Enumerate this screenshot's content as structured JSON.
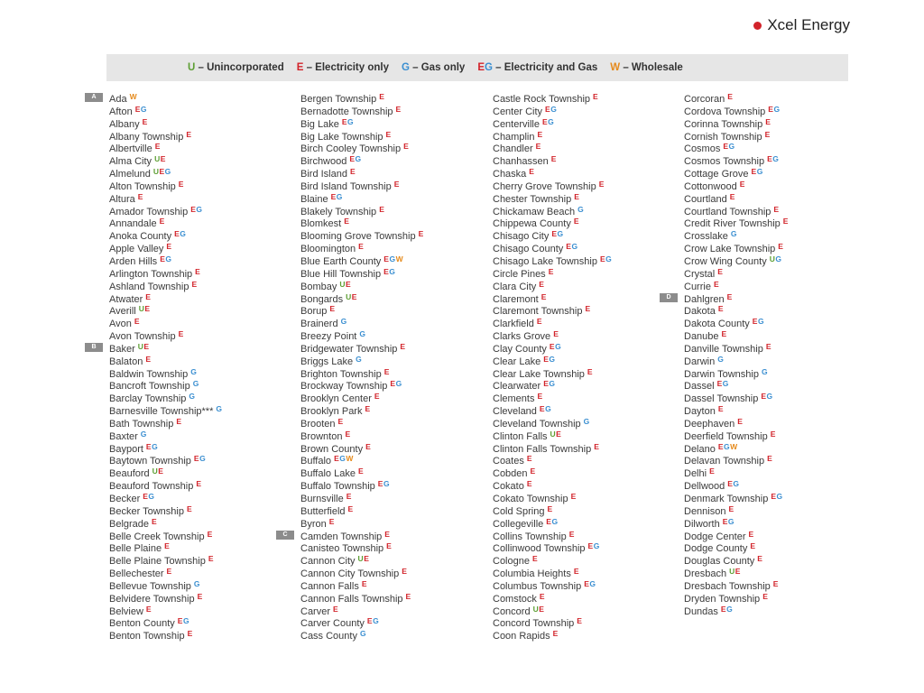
{
  "brand": {
    "name": "Xcel Energy"
  },
  "colors": {
    "U": "#5c9e32",
    "E": "#d2232a",
    "G": "#3b8fd1",
    "W": "#e58a1c",
    "legend_bg": "#e6e6e6"
  },
  "legend": [
    {
      "code": "U",
      "text": "– Unincorporated"
    },
    {
      "code": "E",
      "text": "– Electricity only"
    },
    {
      "code": "G",
      "text": "– Gas only"
    },
    {
      "code": "EG",
      "text": "– Electricity and Gas"
    },
    {
      "code": "W",
      "text": "– Wholesale"
    }
  ],
  "columns": [
    [
      {
        "name": "Ada",
        "codes": "W",
        "letter": "A"
      },
      {
        "name": "Afton",
        "codes": "EG"
      },
      {
        "name": "Albany",
        "codes": "E"
      },
      {
        "name": "Albany Township",
        "codes": "E"
      },
      {
        "name": "Albertville",
        "codes": "E"
      },
      {
        "name": "Alma City",
        "codes": "UE"
      },
      {
        "name": "Almelund",
        "codes": "UEG"
      },
      {
        "name": "Alton Township",
        "codes": "E"
      },
      {
        "name": "Altura",
        "codes": "E"
      },
      {
        "name": "Amador Township",
        "codes": "EG"
      },
      {
        "name": "Annandale",
        "codes": "E"
      },
      {
        "name": "Anoka County",
        "codes": "EG"
      },
      {
        "name": "Apple Valley",
        "codes": "E"
      },
      {
        "name": "Arden Hills",
        "codes": "EG"
      },
      {
        "name": "Arlington Township",
        "codes": "E"
      },
      {
        "name": "Ashland Township",
        "codes": "E"
      },
      {
        "name": "Atwater",
        "codes": "E"
      },
      {
        "name": "Averill",
        "codes": "UE"
      },
      {
        "name": "Avon",
        "codes": "E"
      },
      {
        "name": "Avon Township",
        "codes": "E"
      },
      {
        "name": "Baker",
        "codes": "UE",
        "letter": "B"
      },
      {
        "name": "Balaton",
        "codes": "E"
      },
      {
        "name": "Baldwin Township",
        "codes": "G"
      },
      {
        "name": "Bancroft Township",
        "codes": "G"
      },
      {
        "name": "Barclay Township",
        "codes": "G"
      },
      {
        "name": "Barnesville Township***",
        "codes": "G"
      },
      {
        "name": "Bath Township",
        "codes": "E"
      },
      {
        "name": "Baxter",
        "codes": "G"
      },
      {
        "name": "Bayport",
        "codes": "EG"
      },
      {
        "name": "Baytown Township",
        "codes": "EG"
      },
      {
        "name": "Beauford",
        "codes": "UE"
      },
      {
        "name": "Beauford Township",
        "codes": "E"
      },
      {
        "name": "Becker",
        "codes": "EG"
      },
      {
        "name": "Becker Township",
        "codes": "E"
      },
      {
        "name": "Belgrade",
        "codes": "E"
      },
      {
        "name": "Belle Creek Township",
        "codes": "E"
      },
      {
        "name": "Belle Plaine",
        "codes": "E"
      },
      {
        "name": "Belle Plaine Township",
        "codes": "E"
      },
      {
        "name": "Bellechester",
        "codes": "E"
      },
      {
        "name": "Bellevue Township",
        "codes": "G"
      },
      {
        "name": "Belvidere Township",
        "codes": "E"
      },
      {
        "name": "Belview",
        "codes": "E"
      },
      {
        "name": "Benton County",
        "codes": "EG"
      },
      {
        "name": "Benton Township",
        "codes": "E"
      }
    ],
    [
      {
        "name": "Bergen Township",
        "codes": "E"
      },
      {
        "name": "Bernadotte Township",
        "codes": "E"
      },
      {
        "name": "Big Lake",
        "codes": "EG"
      },
      {
        "name": "Big Lake Township",
        "codes": "E"
      },
      {
        "name": "Birch Cooley Township",
        "codes": "E"
      },
      {
        "name": "Birchwood",
        "codes": "EG"
      },
      {
        "name": "Bird Island",
        "codes": "E"
      },
      {
        "name": "Bird Island Township",
        "codes": "E"
      },
      {
        "name": "Blaine",
        "codes": "EG"
      },
      {
        "name": "Blakely Township",
        "codes": "E"
      },
      {
        "name": "Blomkest",
        "codes": "E"
      },
      {
        "name": "Blooming Grove Township",
        "codes": "E"
      },
      {
        "name": "Bloomington",
        "codes": "E"
      },
      {
        "name": "Blue Earth County",
        "codes": "EGW"
      },
      {
        "name": "Blue Hill Township",
        "codes": "EG"
      },
      {
        "name": "Bombay",
        "codes": "UE"
      },
      {
        "name": "Bongards",
        "codes": "UE"
      },
      {
        "name": "Borup",
        "codes": "E"
      },
      {
        "name": "Brainerd",
        "codes": "G"
      },
      {
        "name": "Breezy Point",
        "codes": "G"
      },
      {
        "name": "Bridgewater Township",
        "codes": "E"
      },
      {
        "name": "Briggs Lake",
        "codes": "G"
      },
      {
        "name": "Brighton Township",
        "codes": "E"
      },
      {
        "name": "Brockway Township",
        "codes": "EG"
      },
      {
        "name": "Brooklyn Center",
        "codes": "E"
      },
      {
        "name": "Brooklyn Park",
        "codes": "E"
      },
      {
        "name": "Brooten",
        "codes": "E"
      },
      {
        "name": "Brownton",
        "codes": "E"
      },
      {
        "name": "Brown County",
        "codes": "E"
      },
      {
        "name": "Buffalo",
        "codes": "EGW"
      },
      {
        "name": "Buffalo Lake",
        "codes": "E"
      },
      {
        "name": "Buffalo Township",
        "codes": "EG"
      },
      {
        "name": "Burnsville",
        "codes": "E"
      },
      {
        "name": "Butterfield",
        "codes": "E"
      },
      {
        "name": "Byron",
        "codes": "E"
      },
      {
        "name": "Camden Township",
        "codes": "E",
        "letter": "C"
      },
      {
        "name": "Canisteo Township",
        "codes": "E"
      },
      {
        "name": "Cannon City",
        "codes": "UE"
      },
      {
        "name": "Cannon City Township",
        "codes": "E"
      },
      {
        "name": "Cannon Falls",
        "codes": "E"
      },
      {
        "name": "Cannon Falls Township",
        "codes": "E"
      },
      {
        "name": "Carver",
        "codes": "E"
      },
      {
        "name": "Carver County",
        "codes": "EG"
      },
      {
        "name": "Cass County",
        "codes": "G"
      }
    ],
    [
      {
        "name": "Castle Rock Township",
        "codes": "E"
      },
      {
        "name": "Center City",
        "codes": "EG"
      },
      {
        "name": "Centerville",
        "codes": "EG"
      },
      {
        "name": "Champlin",
        "codes": "E"
      },
      {
        "name": "Chandler",
        "codes": "E"
      },
      {
        "name": "Chanhassen",
        "codes": "E"
      },
      {
        "name": "Chaska",
        "codes": "E"
      },
      {
        "name": "Cherry Grove Township",
        "codes": "E"
      },
      {
        "name": "Chester Township",
        "codes": "E"
      },
      {
        "name": "Chickamaw Beach",
        "codes": "G"
      },
      {
        "name": "Chippewa County",
        "codes": "E"
      },
      {
        "name": "Chisago City",
        "codes": "EG"
      },
      {
        "name": "Chisago County",
        "codes": "EG"
      },
      {
        "name": "Chisago Lake Township",
        "codes": "EG"
      },
      {
        "name": "Circle Pines",
        "codes": "E"
      },
      {
        "name": "Clara City",
        "codes": "E"
      },
      {
        "name": "Claremont",
        "codes": "E"
      },
      {
        "name": "Claremont Township",
        "codes": "E"
      },
      {
        "name": "Clarkfield",
        "codes": "E"
      },
      {
        "name": "Clarks Grove",
        "codes": "E"
      },
      {
        "name": "Clay County",
        "codes": "EG"
      },
      {
        "name": "Clear Lake",
        "codes": "EG"
      },
      {
        "name": "Clear Lake Township",
        "codes": "E"
      },
      {
        "name": "Clearwater",
        "codes": "EG"
      },
      {
        "name": "Clements",
        "codes": "E"
      },
      {
        "name": "Cleveland",
        "codes": "EG"
      },
      {
        "name": "Cleveland Township",
        "codes": "G"
      },
      {
        "name": "Clinton Falls",
        "codes": "UE"
      },
      {
        "name": "Clinton Falls Township",
        "codes": "E"
      },
      {
        "name": "Coates",
        "codes": "E"
      },
      {
        "name": "Cobden",
        "codes": "E"
      },
      {
        "name": "Cokato",
        "codes": "E"
      },
      {
        "name": "Cokato Township",
        "codes": "E"
      },
      {
        "name": "Cold Spring",
        "codes": "E"
      },
      {
        "name": "Collegeville",
        "codes": "EG"
      },
      {
        "name": "Collins Township",
        "codes": "E"
      },
      {
        "name": "Collinwood Township",
        "codes": "EG"
      },
      {
        "name": "Cologne",
        "codes": "E"
      },
      {
        "name": "Columbia Heights",
        "codes": "E"
      },
      {
        "name": "Columbus Township",
        "codes": "EG"
      },
      {
        "name": "Comstock",
        "codes": "E"
      },
      {
        "name": "Concord",
        "codes": "UE"
      },
      {
        "name": "Concord Township",
        "codes": "E"
      },
      {
        "name": "Coon Rapids",
        "codes": "E"
      }
    ],
    [
      {
        "name": "Corcoran",
        "codes": "E"
      },
      {
        "name": "Cordova Township",
        "codes": "EG"
      },
      {
        "name": "Corinna Township",
        "codes": "E"
      },
      {
        "name": "Cornish Township",
        "codes": "E"
      },
      {
        "name": "Cosmos",
        "codes": "EG"
      },
      {
        "name": "Cosmos Township",
        "codes": "EG"
      },
      {
        "name": "Cottage Grove",
        "codes": "EG"
      },
      {
        "name": "Cottonwood",
        "codes": "E"
      },
      {
        "name": "Courtland",
        "codes": "E"
      },
      {
        "name": "Courtland Township",
        "codes": "E"
      },
      {
        "name": "Credit River Township",
        "codes": "E"
      },
      {
        "name": "Crosslake",
        "codes": "G"
      },
      {
        "name": "Crow Lake Township",
        "codes": "E"
      },
      {
        "name": "Crow Wing County",
        "codes": "UG"
      },
      {
        "name": "Crystal",
        "codes": "E"
      },
      {
        "name": "Currie",
        "codes": "E"
      },
      {
        "name": "Dahlgren",
        "codes": "E",
        "letter": "D"
      },
      {
        "name": "Dakota",
        "codes": "E"
      },
      {
        "name": "Dakota County",
        "codes": "EG"
      },
      {
        "name": "Danube",
        "codes": "E"
      },
      {
        "name": "Danville Township",
        "codes": "E"
      },
      {
        "name": "Darwin",
        "codes": "G"
      },
      {
        "name": "Darwin Township",
        "codes": "G"
      },
      {
        "name": "Dassel",
        "codes": "EG"
      },
      {
        "name": "Dassel Township",
        "codes": "EG"
      },
      {
        "name": "Dayton",
        "codes": "E"
      },
      {
        "name": "Deephaven",
        "codes": "E"
      },
      {
        "name": "Deerfield Township",
        "codes": "E"
      },
      {
        "name": "Delano",
        "codes": "EGW"
      },
      {
        "name": "Delavan Township",
        "codes": "E"
      },
      {
        "name": "Delhi",
        "codes": "E"
      },
      {
        "name": "Dellwood",
        "codes": "EG"
      },
      {
        "name": "Denmark Township",
        "codes": "EG"
      },
      {
        "name": "Dennison",
        "codes": "E"
      },
      {
        "name": "Dilworth",
        "codes": "EG"
      },
      {
        "name": "Dodge Center",
        "codes": "E"
      },
      {
        "name": "Dodge County",
        "codes": "E"
      },
      {
        "name": "Douglas County",
        "codes": "E"
      },
      {
        "name": "Dresbach",
        "codes": "UE"
      },
      {
        "name": "Dresbach Township",
        "codes": "E"
      },
      {
        "name": "Dryden Township",
        "codes": "E"
      },
      {
        "name": "Dundas",
        "codes": "EG"
      }
    ]
  ]
}
